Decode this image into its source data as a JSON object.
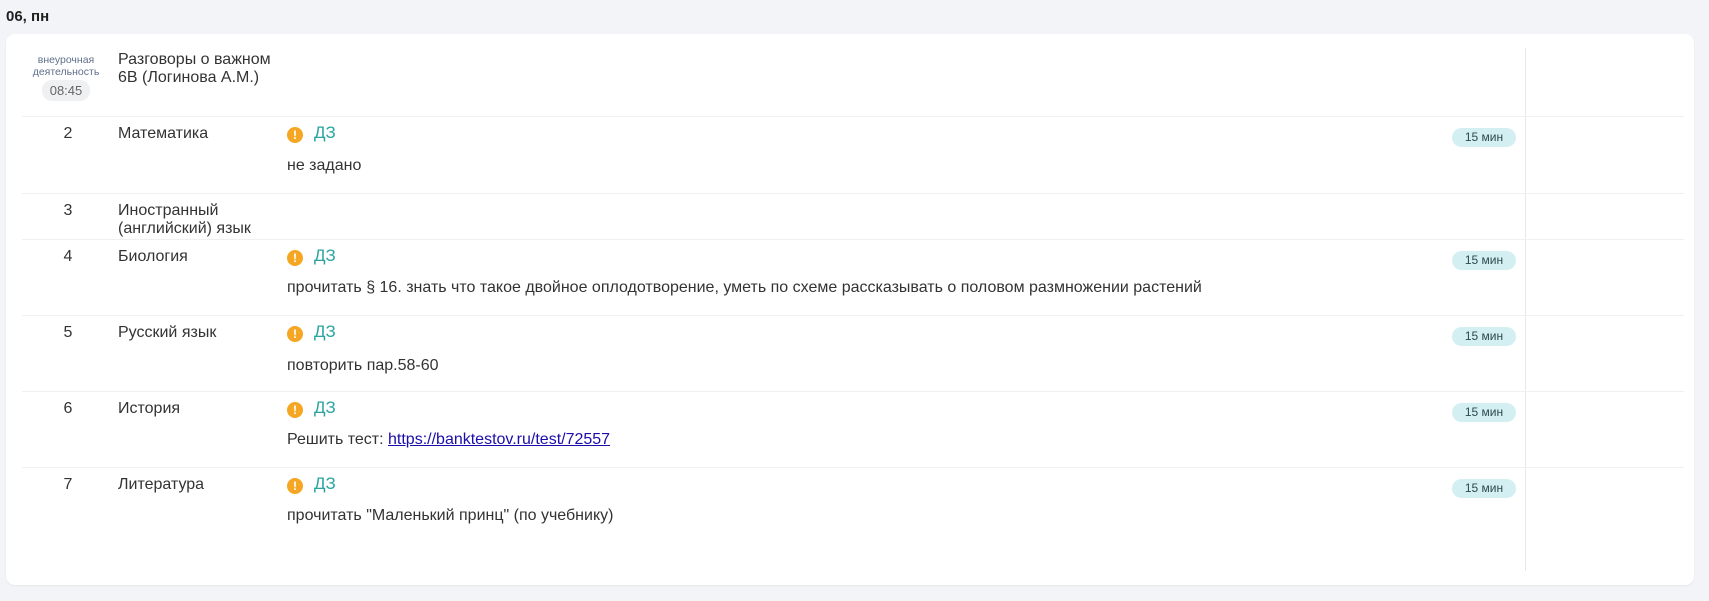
{
  "day": "06, пн",
  "extra": {
    "label_line1": "внеурочная",
    "label_line2": "деятельность",
    "time": "08:45",
    "subject_line1": "Разговоры о важном",
    "subject_line2": "6В (Логинова А.М.)"
  },
  "lessons": [
    {
      "num": "2",
      "subject": "Математика",
      "dz": "ДЗ",
      "badge": "15 мин",
      "homework": "не задано"
    },
    {
      "num": "3",
      "subject_line1": "Иностранный",
      "subject_line2": "(английский) язык"
    },
    {
      "num": "4",
      "subject": "Биология",
      "dz": "ДЗ",
      "badge": "15 мин",
      "homework": "прочитать § 16. знать что такое двойное оплодотворение, уметь по схеме рассказывать о половом размножении растений"
    },
    {
      "num": "5",
      "subject": "Русский язык",
      "dz": "ДЗ",
      "badge": "15 мин",
      "homework": "повторить пар.58-60"
    },
    {
      "num": "6",
      "subject": "История",
      "dz": "ДЗ",
      "badge": "15 мин",
      "homework_prefix": "Решить тест: ",
      "homework_link": "https://banktestov.ru/test/72557"
    },
    {
      "num": "7",
      "subject": "Литература",
      "dz": "ДЗ",
      "badge": "15 мин",
      "homework": "прочитать \"Маленький принц\" (по учебнику)"
    }
  ],
  "colors": {
    "accent": "#2aa4a0",
    "warning": "#f5a623",
    "badge_bg": "#d3eff2",
    "link": "#1a0dab"
  },
  "icons": {
    "warning": "exclamation-circle-icon"
  }
}
